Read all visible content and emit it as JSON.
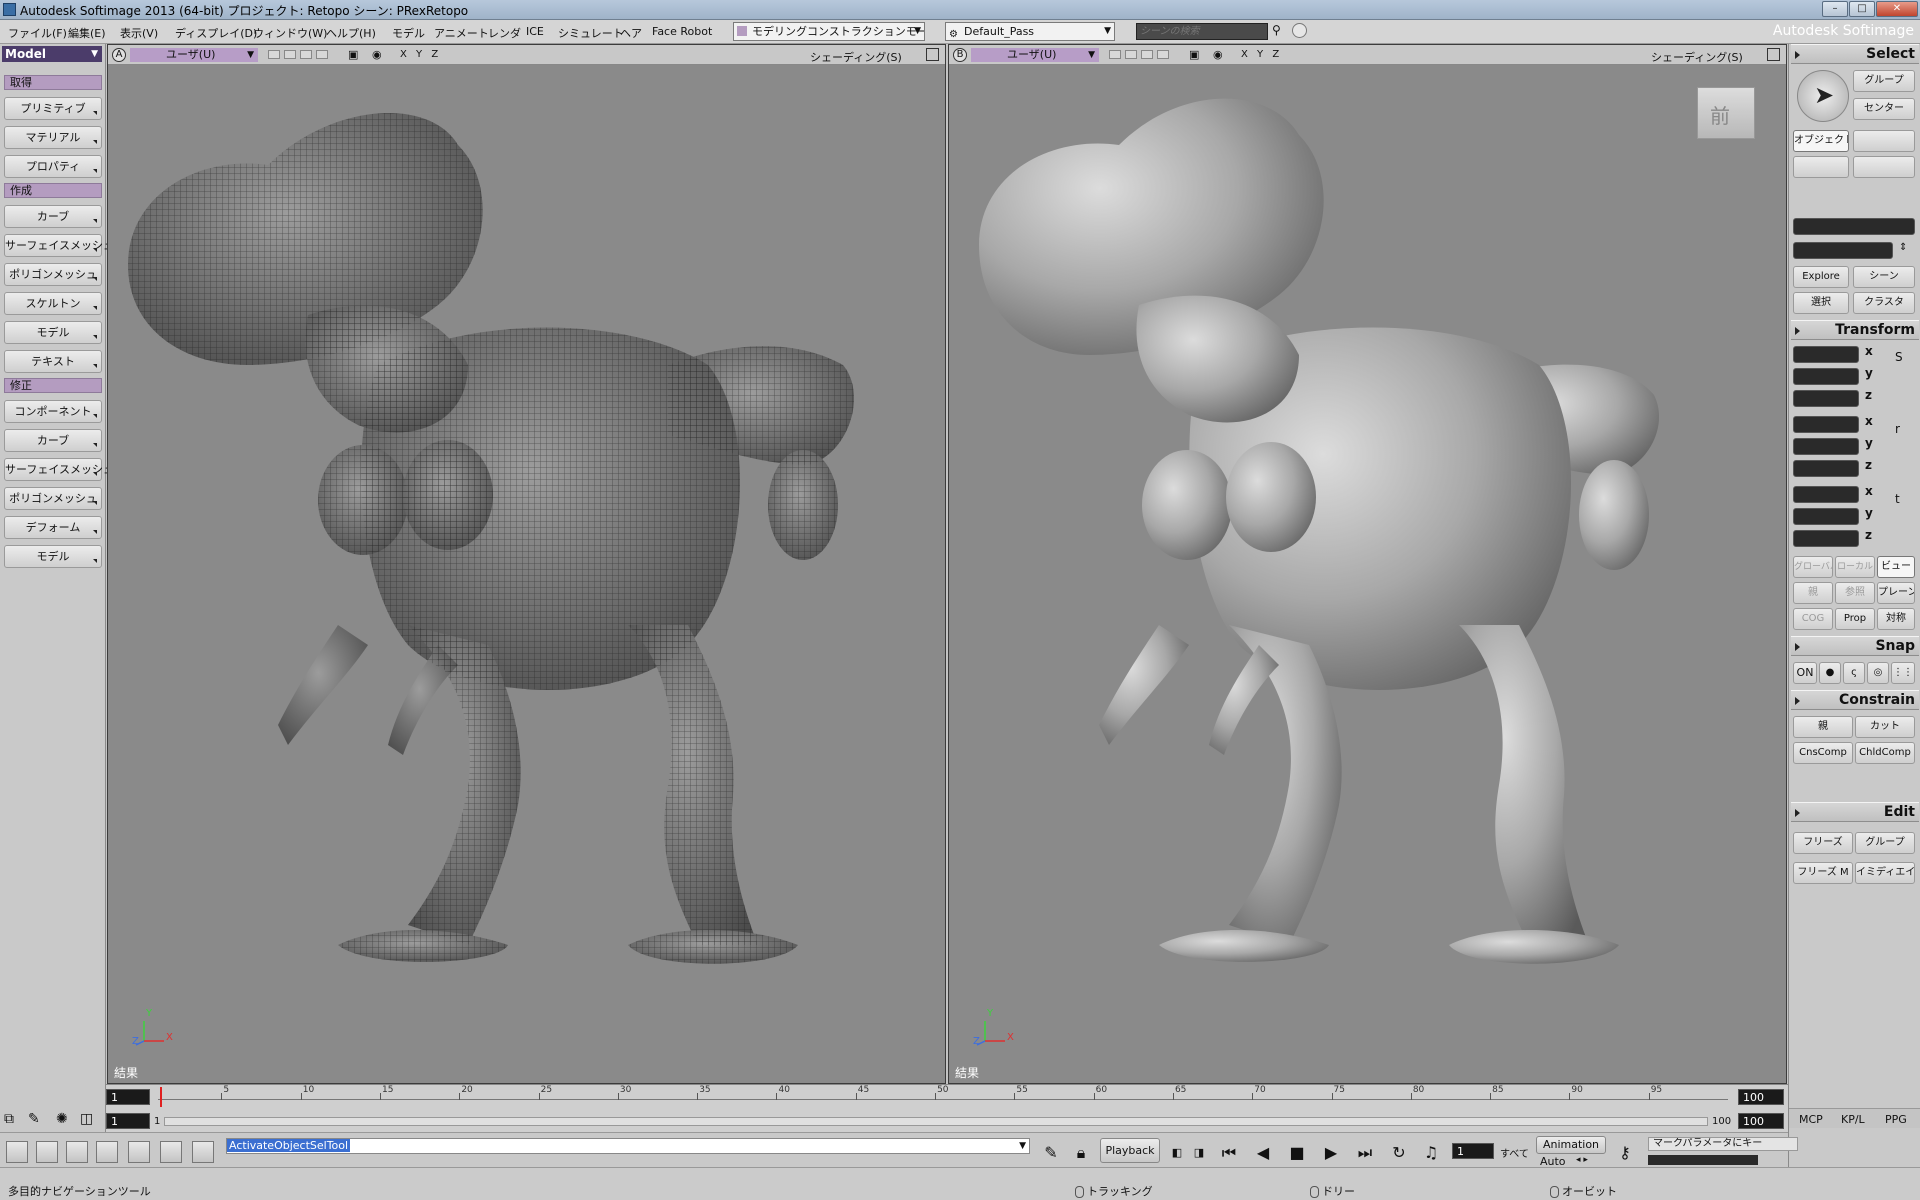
{
  "window": {
    "title": "Autodesk Softimage 2013 (64-bit)    プロジェクト: Retopo    シーン: PRexRetopo",
    "brand": "Autodesk Softimage"
  },
  "menubar": {
    "items": [
      "ファイル(F)",
      "編集(E)",
      "表示(V)",
      "ディスプレイ(D)",
      "ウィンドウ(W)",
      "ヘルプ(H)",
      "モデル",
      "アニメート",
      "レンダ",
      "ICE",
      "シミュレート",
      "ヘア",
      "Face Robot"
    ],
    "mode_select": "モデリングコンストラクションモード",
    "pass_select": "Default_Pass",
    "search_placeholder": "シーンの検索"
  },
  "left_palette": {
    "mode": "Model",
    "sections": [
      {
        "title": "取得",
        "buttons": [
          "プリミティブ",
          "マテリアル",
          "プロパティ"
        ]
      },
      {
        "title": "作成",
        "buttons": [
          "カーブ",
          "サーフェイスメッシュ",
          "ポリゴンメッシュ",
          "スケルトン",
          "モデル",
          "テキスト"
        ]
      },
      {
        "title": "修正",
        "buttons": [
          "コンポーネント",
          "カーブ",
          "サーフェイスメッシュ",
          "ポリゴンメッシュ",
          "デフォーム",
          "モデル"
        ]
      }
    ]
  },
  "viewports": [
    {
      "letter": "A",
      "camera": "ユーザ(U)",
      "shading": "シェーディング(S)",
      "axes": "X Y Z",
      "result_label": "結果",
      "axis_y": "Y",
      "axis_x": "X",
      "axis_z": "Z"
    },
    {
      "letter": "B",
      "camera": "ユーザ(U)",
      "shading": "シェーディング(S)",
      "axes": "X Y Z",
      "result_label": "結果",
      "axis_y": "Y",
      "axis_x": "X",
      "axis_z": "Z",
      "view_cube": "前"
    }
  ],
  "right_panel": {
    "select": {
      "header": "Select",
      "group": "グループ",
      "center": "センター",
      "object": "オブジェクト",
      "explore": "Explore",
      "scene": "シーン",
      "selection": "選択",
      "cluster": "クラスタ"
    },
    "transform": {
      "header": "Transform",
      "axes": [
        "x",
        "y",
        "z"
      ],
      "global": "グローバル",
      "local": "ローカル",
      "view": "ビュー",
      "parent": "親",
      "reference": "参照",
      "plane": "プレーン",
      "cog": "COG",
      "prop": "Prop",
      "symmetry": "対称"
    },
    "snap": {
      "header": "Snap",
      "on": "ON"
    },
    "constrain": {
      "header": "Constrain",
      "parent": "親",
      "cut": "カット",
      "cnscomp": "CnsComp",
      "chldcomp": "ChldComp"
    },
    "edit": {
      "header": "Edit",
      "freeze": "フリーズ",
      "group": "グループ",
      "freeze_m": "フリーズ M",
      "immediate": "イミディエイト"
    },
    "tabs": [
      "MCP",
      "KP/L",
      "PPG"
    ]
  },
  "timeline": {
    "start": "1",
    "end": "100",
    "current_start": "1",
    "range_end": "100",
    "range_start_small": "1",
    "range_end_small": "100",
    "ticks": [
      "5",
      "10",
      "15",
      "20",
      "25",
      "30",
      "35",
      "40",
      "45",
      "50",
      "55",
      "60",
      "65",
      "70",
      "75",
      "80",
      "85",
      "90",
      "95"
    ]
  },
  "command": {
    "text": "ActivateObjectSelTool",
    "playback": "Playback",
    "frame": "1",
    "all": "すべて",
    "animation": "Animation",
    "auto": "Auto",
    "key_label": "マークパラメータにキー"
  },
  "status": {
    "left": "多目的ナビゲーションツール",
    "l_hint": "トラッキング",
    "m_hint": "ドリー",
    "r_hint": "オービット"
  }
}
